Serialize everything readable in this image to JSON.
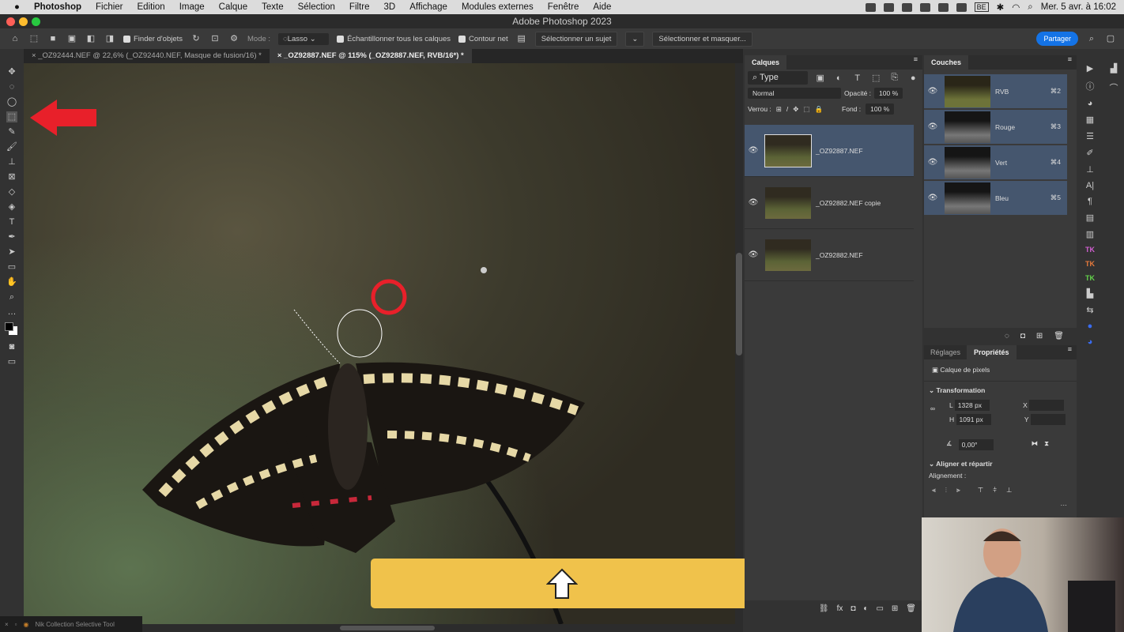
{
  "menubar": {
    "app": "Photoshop",
    "items": [
      "Fichier",
      "Edition",
      "Image",
      "Calque",
      "Texte",
      "Sélection",
      "Filtre",
      "3D",
      "Affichage",
      "Modules externes",
      "Fenêtre",
      "Aide"
    ],
    "input_source": "BE",
    "clock": "Mer. 5 avr. à 16:02"
  },
  "window": {
    "title": "Adobe Photoshop 2023"
  },
  "options": {
    "object_finder": "Finder d'objets",
    "mode_label": "Mode :",
    "mode_value": "Lasso",
    "sample_all": "Échantillonner tous les calques",
    "hard_edge": "Contour net",
    "select_subject": "Sélectionner un sujet",
    "select_mask": "Sélectionner et masquer...",
    "share": "Partager"
  },
  "tabs": [
    {
      "label": "_OZ92444.NEF @ 22,6% (_OZ92440.NEF, Masque de fusion/16) *",
      "active": false
    },
    {
      "label": "_OZ92887.NEF @ 115% (_OZ92887.NEF, RVB/16*) *",
      "active": true
    }
  ],
  "layers": {
    "title": "Calques",
    "filter": "Type",
    "blend": "Normal",
    "opacity_label": "Opacité :",
    "opacity": "100 %",
    "lock_label": "Verrou :",
    "fill_label": "Fond :",
    "fill": "100 %",
    "items": [
      {
        "name": "_OZ92887.NEF",
        "selected": true
      },
      {
        "name": "_OZ92882.NEF copie",
        "selected": false
      },
      {
        "name": "_OZ92882.NEF",
        "selected": false
      }
    ]
  },
  "channels": {
    "title": "Couches",
    "items": [
      {
        "name": "RVB",
        "shortcut": "⌘2"
      },
      {
        "name": "Rouge",
        "shortcut": "⌘3"
      },
      {
        "name": "Vert",
        "shortcut": "⌘4"
      },
      {
        "name": "Bleu",
        "shortcut": "⌘5"
      }
    ]
  },
  "properties": {
    "tab_adjust": "Réglages",
    "tab_props": "Propriétés",
    "kind": "Calque de pixels",
    "transform": "Transformation",
    "w_label": "L",
    "w": "1328 px",
    "h_label": "H",
    "h": "1091 px",
    "x_label": "X",
    "y_label": "Y",
    "angle": "0,00°",
    "align_section": "Aligner et répartir",
    "align_label": "Alignement :"
  },
  "plugin": {
    "label": "Nik Collection Selective Tool"
  },
  "colors": {
    "accent": "#1473e6",
    "selected_layer": "#45566e",
    "banner": "#f0c24b",
    "annotation": "#e8202a"
  }
}
